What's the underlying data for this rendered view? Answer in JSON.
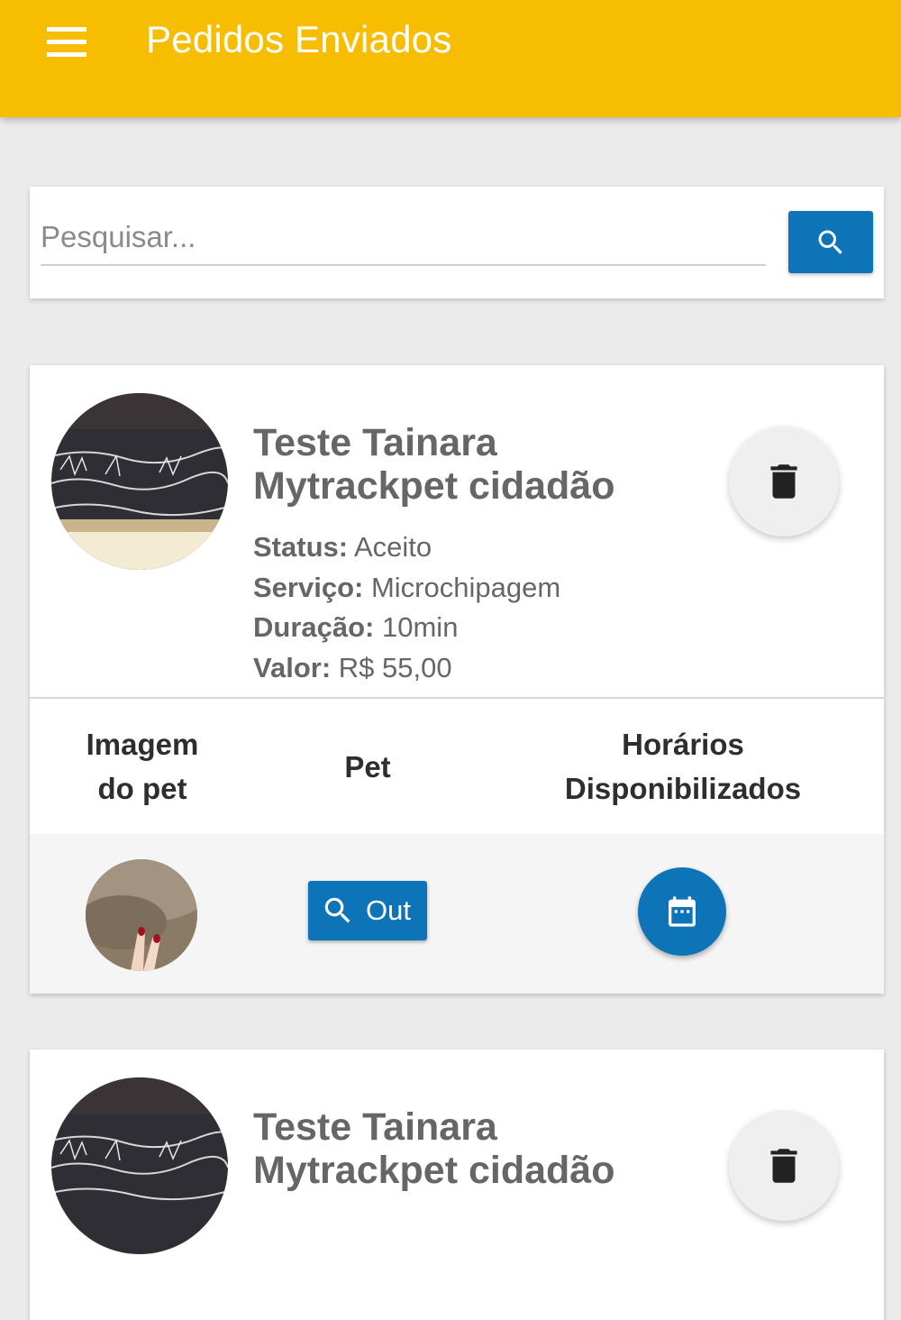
{
  "appbar": {
    "title": "Pedidos Enviados",
    "menu_icon": "hamburger-menu-icon"
  },
  "search": {
    "placeholder": "Pesquisar...",
    "value": "",
    "button_icon": "search-icon"
  },
  "orders": [
    {
      "owner_line1": "Teste Tainara",
      "owner_line2": "Mytrackpet cidadão",
      "status_label": "Status:",
      "status": "Aceito",
      "service_label": "Serviço:",
      "service": "Microchipagem",
      "duration_label": "Duração:",
      "duration": "10min",
      "price_label": "Valor:",
      "price": "R$ 55,00",
      "table": {
        "col_image_line1": "Imagem",
        "col_image_line2": "do pet",
        "col_pet": "Pet",
        "col_times_line1": "Horários",
        "col_times_line2": "Disponibilizados",
        "pet_button_label": "Out"
      }
    },
    {
      "owner_line1": "Teste Tainara",
      "owner_line2": "Mytrackpet cidadão"
    }
  ],
  "colors": {
    "appbar": "#f7bd00",
    "primary_button": "#0d74b8",
    "background": "#ebebeb"
  }
}
